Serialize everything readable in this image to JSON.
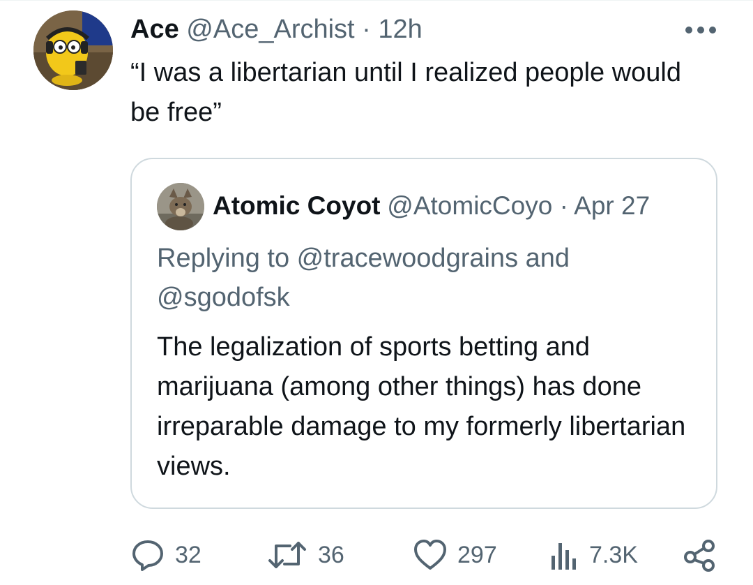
{
  "tweet": {
    "author_name": "Ace",
    "author_handle": "@Ace_Archist",
    "separator": "·",
    "time": "12h",
    "text": "“I was a libertarian until I realized people would be free”",
    "more_icon": "more-horizontal-icon"
  },
  "quoted_tweet": {
    "author_name": "Atomic Coyote",
    "author_handle": "@AtomicCoyo",
    "separator": "·",
    "date": "Apr 27",
    "replying_to": "Replying to @tracewoodgrains and @sgodofsk",
    "text": "The legalization of sports betting and marijuana (among other things) has done irreparable damage to my formerly libertarian views."
  },
  "actions": {
    "replies": "32",
    "retweets": "36",
    "likes": "297",
    "views": "7.3K",
    "icons": [
      "reply-icon",
      "retweet-icon",
      "like-icon",
      "views-icon",
      "share-icon"
    ]
  },
  "colors": {
    "text_primary": "#0f1419",
    "text_secondary": "#536471",
    "border": "#cfd9de",
    "avatar_yellow": "#f2c81a"
  }
}
